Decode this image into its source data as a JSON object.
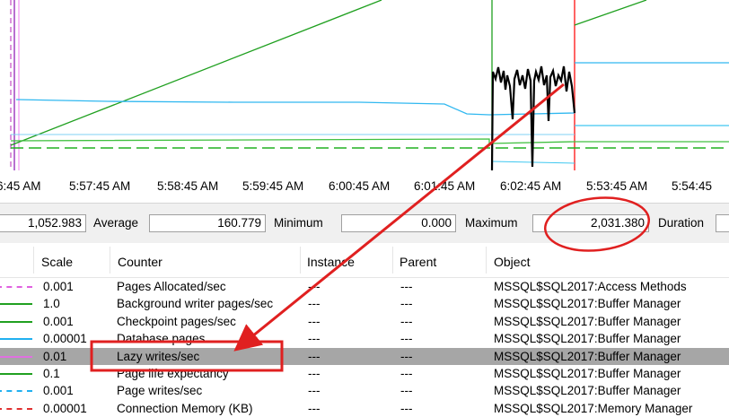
{
  "time_axis": {
    "ticks": [
      "6:45 AM",
      "5:57:45 AM",
      "5:58:45 AM",
      "5:59:45 AM",
      "6:00:45 AM",
      "6:01:45 AM",
      "6:02:45 AM",
      "5:53:45 AM",
      "5:54:45"
    ]
  },
  "stats": {
    "last_value": "1,052.983",
    "average_label": "Average",
    "average_value": "160.779",
    "minimum_label": "Minimum",
    "minimum_value": "0.000",
    "maximum_label": "Maximum",
    "maximum_value": "2,031.380",
    "duration_label": "Duration"
  },
  "columns": [
    "Scale",
    "Counter",
    "Instance",
    "Parent",
    "Object"
  ],
  "rows": [
    {
      "color": "#e060e0",
      "dash": true,
      "scale": "0.001",
      "counter": "Pages Allocated/sec",
      "instance": "---",
      "parent": "---",
      "object": "MSSQL$SQL2017:Access Methods",
      "selected": false
    },
    {
      "color": "#20a020",
      "dash": false,
      "scale": "1.0",
      "counter": "Background writer pages/sec",
      "instance": "---",
      "parent": "---",
      "object": "MSSQL$SQL2017:Buffer Manager",
      "selected": false
    },
    {
      "color": "#20a020",
      "dash": false,
      "scale": "0.001",
      "counter": "Checkpoint pages/sec",
      "instance": "---",
      "parent": "---",
      "object": "MSSQL$SQL2017:Buffer Manager",
      "selected": false
    },
    {
      "color": "#20b0f0",
      "dash": false,
      "scale": "0.00001",
      "counter": "Database pages",
      "instance": "---",
      "parent": "---",
      "object": "MSSQL$SQL2017:Buffer Manager",
      "selected": false
    },
    {
      "color": "#e070e0",
      "dash": false,
      "scale": "0.01",
      "counter": "Lazy writes/sec",
      "instance": "---",
      "parent": "---",
      "object": "MSSQL$SQL2017:Buffer Manager",
      "selected": true
    },
    {
      "color": "#20a020",
      "dash": false,
      "scale": "0.1",
      "counter": "Page life expectancy",
      "instance": "---",
      "parent": "---",
      "object": "MSSQL$SQL2017:Buffer Manager",
      "selected": false
    },
    {
      "color": "#20b0f0",
      "dash": true,
      "scale": "0.001",
      "counter": "Page writes/sec",
      "instance": "---",
      "parent": "---",
      "object": "MSSQL$SQL2017:Buffer Manager",
      "selected": false
    },
    {
      "color": "#e03030",
      "dash": true,
      "scale": "0.00001",
      "counter": "Connection Memory (KB)",
      "instance": "---",
      "parent": "---",
      "object": "MSSQL$SQL2017:Memory Manager",
      "selected": false
    }
  ],
  "colors": {
    "annotation_red": "#e02020",
    "selected_row": "#a6a6a6"
  }
}
